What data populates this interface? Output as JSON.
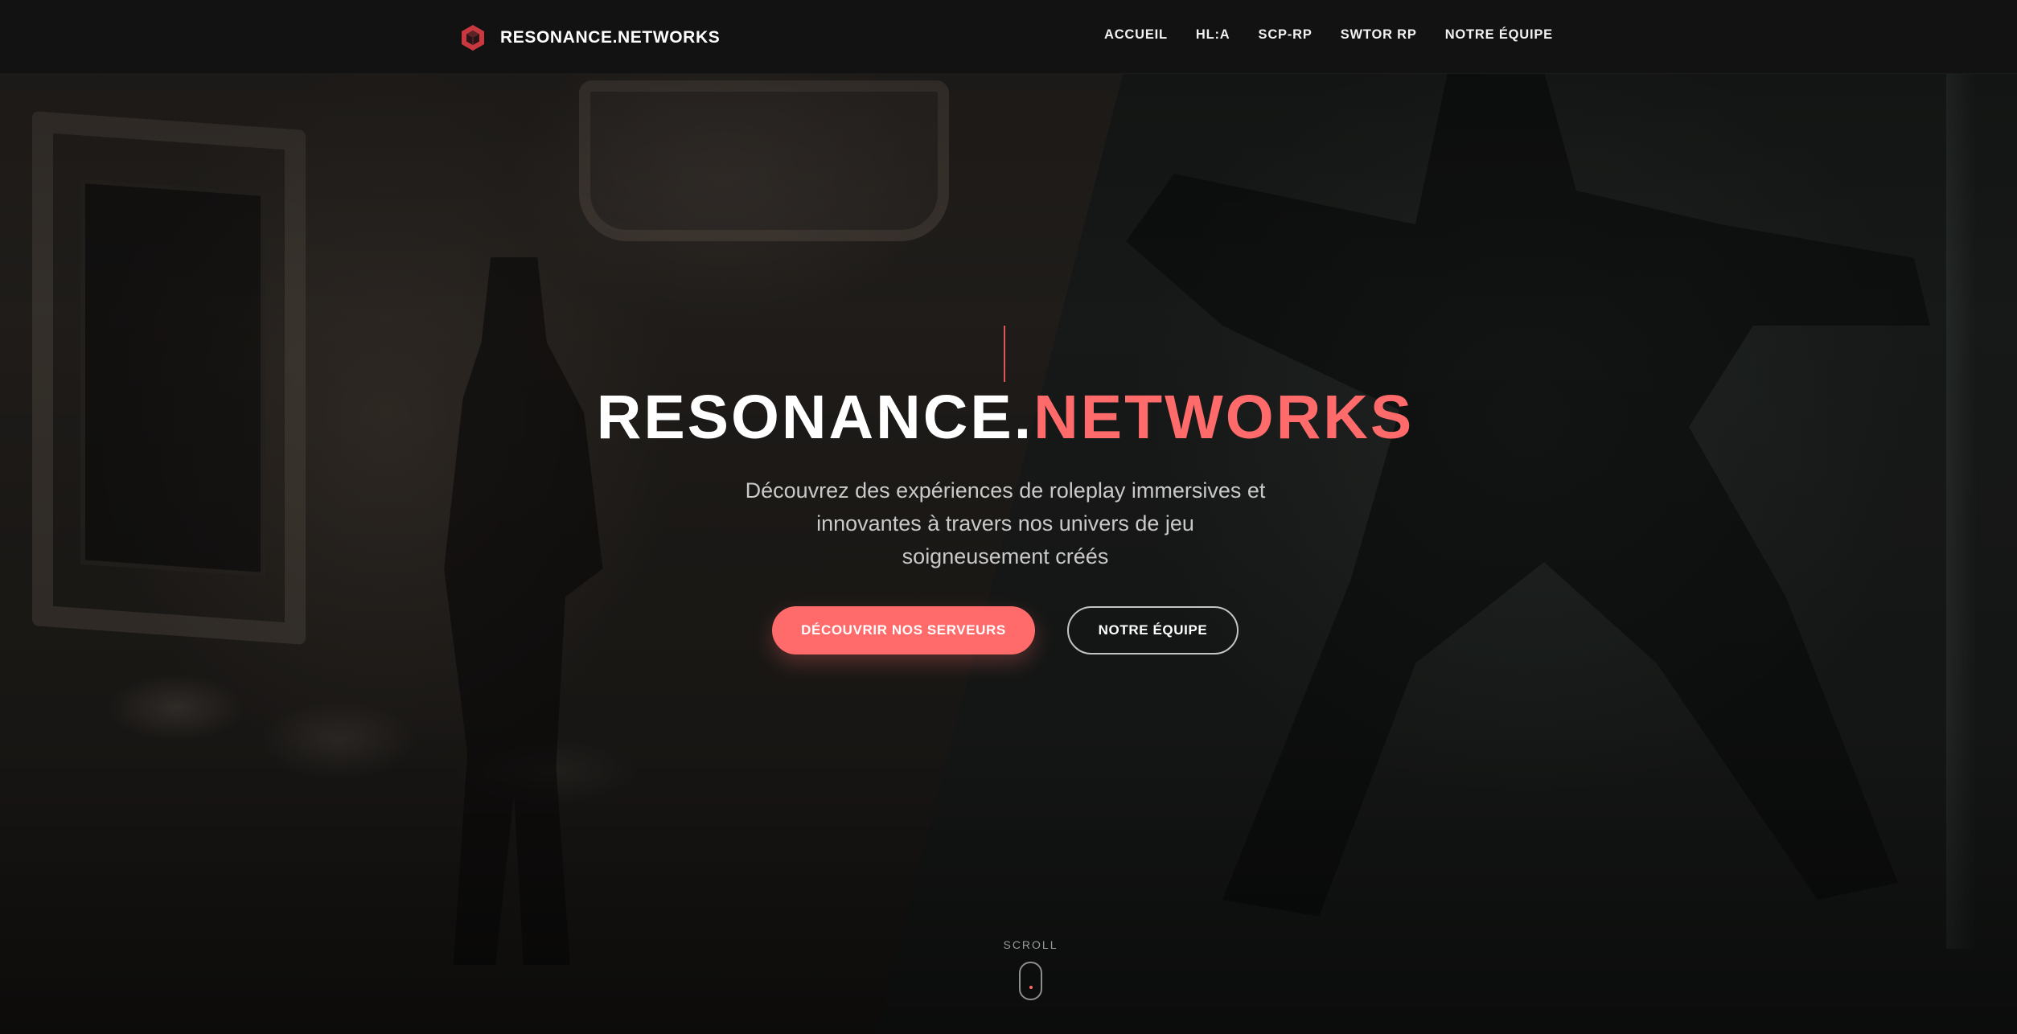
{
  "navbar": {
    "brand": "RESONANCE.NETWORKS",
    "brand_icon": "hexagon-cube-logo",
    "links": [
      {
        "label": "ACCUEIL"
      },
      {
        "label": "HL:A"
      },
      {
        "label": "SCP-RP"
      },
      {
        "label": "SWTOR RP"
      },
      {
        "label": "NOTRE ÉQUIPE"
      }
    ]
  },
  "hero": {
    "title_main": "RESONANCE.",
    "title_accent": "NETWORKS",
    "subtitle_lines": [
      "Découvrez des expériences de roleplay immersives et",
      "innovantes à travers nos univers de jeu",
      "soigneusement créés"
    ],
    "primary_button": "DÉCOUVRIR NOS SERVEURS",
    "secondary_button": "NOTRE ÉQUIPE"
  },
  "scroll": {
    "label": "SCROLL",
    "icon": "mouse-scroll-icon"
  },
  "colors": {
    "accent": "#ff6b6b",
    "navbar_bg": "#121212",
    "text": "#ffffff",
    "subtitle": "#c9c9c9"
  }
}
